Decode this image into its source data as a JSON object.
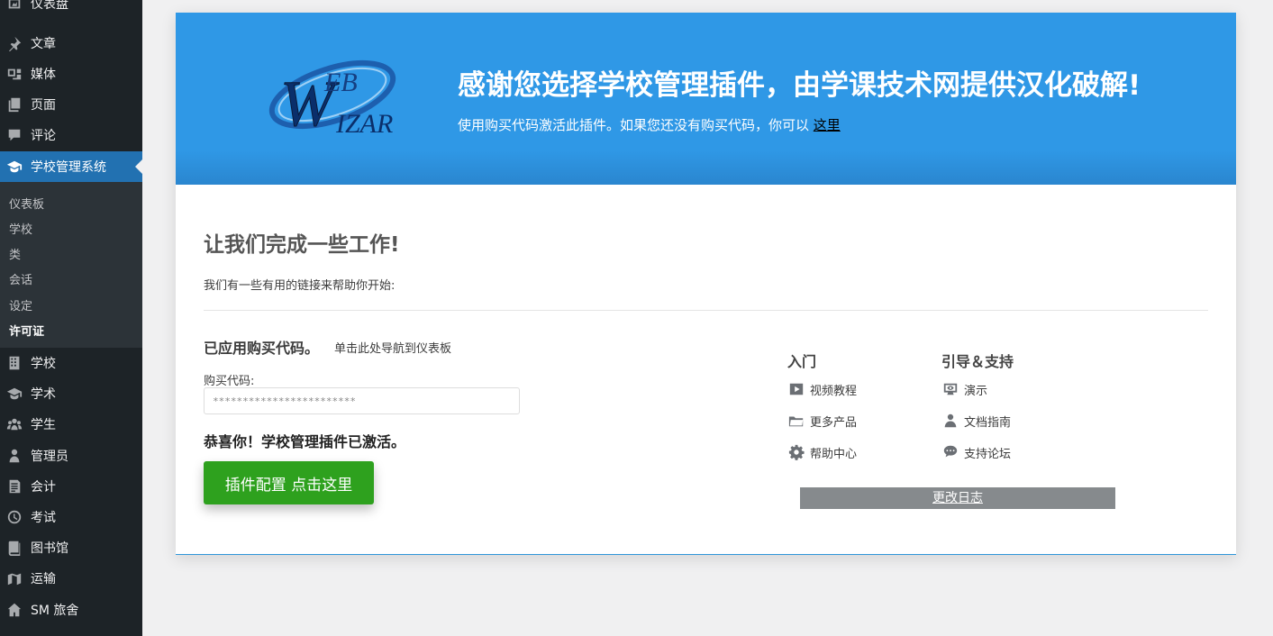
{
  "sidebar": {
    "items": [
      {
        "label": "仪表盘",
        "icon": "dashboard-icon"
      },
      {
        "label": "文章",
        "icon": "pin-icon"
      },
      {
        "label": "媒体",
        "icon": "media-icon"
      },
      {
        "label": "页面",
        "icon": "page-icon"
      },
      {
        "label": "评论",
        "icon": "comment-icon"
      },
      {
        "label": "学校管理系统",
        "icon": "graduation-cap-icon",
        "active": true
      },
      {
        "label": "学校",
        "icon": "building-icon"
      },
      {
        "label": "学术",
        "icon": "graduation-cap-icon"
      },
      {
        "label": "学生",
        "icon": "groups-icon"
      },
      {
        "label": "管理员",
        "icon": "admin-user-icon"
      },
      {
        "label": "会计",
        "icon": "ledger-icon"
      },
      {
        "label": "考试",
        "icon": "clock-icon"
      },
      {
        "label": "图书馆",
        "icon": "book-icon"
      },
      {
        "label": "运输",
        "icon": "transport-icon"
      },
      {
        "label": "SM 旅舍",
        "icon": "home-icon"
      }
    ],
    "submenu": [
      {
        "label": "仪表板"
      },
      {
        "label": "学校"
      },
      {
        "label": "类"
      },
      {
        "label": "会话"
      },
      {
        "label": "设定"
      },
      {
        "label": "许可证",
        "current": true
      }
    ]
  },
  "banner": {
    "logo_text": "WEB WIZAR",
    "title": "感谢您选择学校管理插件，由学课技术网提供汉化破解!",
    "subtitle": "使用购买代码激活此插件。如果您还没有购买代码，你可以",
    "link": "这里"
  },
  "main": {
    "heading": "让我们完成一些工作!",
    "description": "我们有一些有用的链接来帮助你开始:",
    "applied_title": "已应用购买代码。",
    "dashboard_link": "单击此处导航到仪表板",
    "code_label": "购买代码:",
    "code_value": "************************",
    "congrats": "恭喜你！学校管理插件已激活。",
    "config_button": "插件配置 点击这里"
  },
  "links": {
    "col1": {
      "title": "入门",
      "items": [
        {
          "label": "视频教程",
          "icon": "video-play-icon"
        },
        {
          "label": "更多产品",
          "icon": "folder-icon"
        },
        {
          "label": "帮助中心",
          "icon": "gear-icon"
        }
      ]
    },
    "col2": {
      "title": "引导＆支持",
      "items": [
        {
          "label": "演示",
          "icon": "visibility-icon"
        },
        {
          "label": "文档指南",
          "icon": "person-icon"
        },
        {
          "label": "支持论坛",
          "icon": "chat-bubbles-icon"
        }
      ]
    }
  },
  "changelog": "更改日志"
}
